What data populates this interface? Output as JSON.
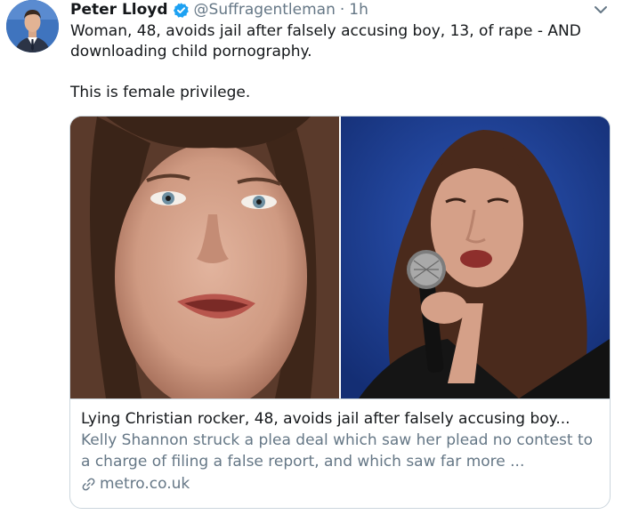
{
  "tweet": {
    "author_name": "Peter Lloyd",
    "author_handle": "@Suffragentleman",
    "separator": "·",
    "time": "1h",
    "text_line1": "Woman, 48, avoids jail after falsely accusing boy, 13, of rape - AND downloading child pornography.",
    "text_line2": "This is female privilege.",
    "icons": {
      "verified": "verified-badge-icon",
      "caret": "chevron-down-icon",
      "link": "link-icon"
    }
  },
  "card": {
    "title": "Lying Christian rocker, 48, avoids jail after falsely accusing boy...",
    "description": "Kelly Shannon struck a plea deal which saw her plead no contest to a charge of filing a false report, and which saw far more ...",
    "domain": "metro.co.uk"
  },
  "colors": {
    "text": "#14171a",
    "secondary": "#657786",
    "verified": "#1da1f2",
    "border": "#ccd6dd"
  }
}
